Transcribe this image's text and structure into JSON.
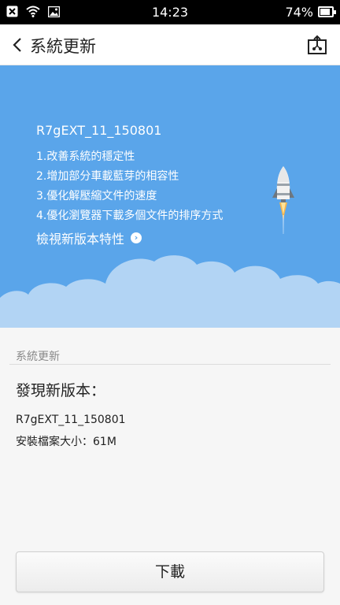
{
  "status_bar": {
    "time": "14:23",
    "battery": "74%",
    "icons": [
      "close-notification-icon",
      "wifi-icon",
      "image-notification-icon"
    ]
  },
  "header": {
    "title": "系統更新",
    "back_icon": "chevron-left-icon",
    "action_icon": "share-icon"
  },
  "banner": {
    "version": "R7gEXT_11_150801",
    "notes": [
      "1.改善系統的穩定性",
      "2.增加部分車載藍芽的相容性",
      "3.優化解壓縮文件的速度",
      "4.優化瀏覽器下載多個文件的排序方式"
    ],
    "view_link": "檢視新版本特性",
    "background_color": "#5aa5ea"
  },
  "info": {
    "section_label": "系統更新",
    "heading": "發現新版本：",
    "version": "R7gEXT_11_150801",
    "size": "安裝檔案大小：61M"
  },
  "download_button": {
    "label": "下載"
  }
}
